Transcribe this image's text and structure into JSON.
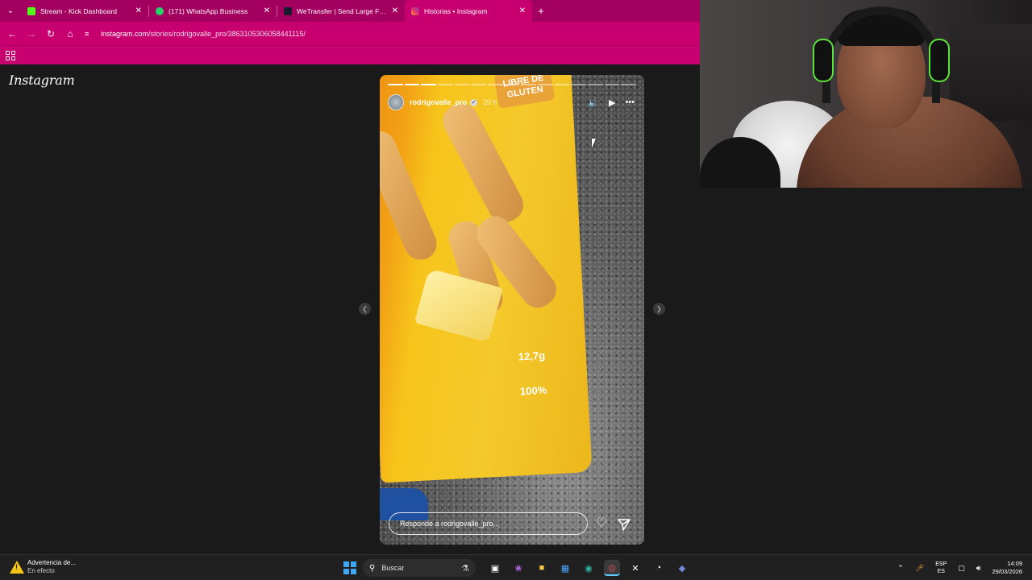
{
  "browser": {
    "tabs": [
      {
        "label": "Stream - Kick Dashboard",
        "favicon_color": "#53fc18",
        "active": false
      },
      {
        "label": "(171) WhatsApp Business",
        "favicon_color": "#25d366",
        "active": false
      },
      {
        "label": "WeTransfer | Send Large Files Fa",
        "favicon_color": "#1a1a2e",
        "active": false
      },
      {
        "label": "Historias • Instagram",
        "favicon_color": "#e1306c",
        "active": true
      }
    ],
    "url_host": "instagram.com",
    "url_path": "/stories/rodrigovalle_pro/3863105306058441115/",
    "theme_color": "#c8006f"
  },
  "page": {
    "logo": "Instagram"
  },
  "story": {
    "username": "rodrigovalle_pro",
    "time_ago": "20 h",
    "reply_placeholder": "Responde a rodrigovalle_pro...",
    "segments_total": 15,
    "segments_done": 3,
    "bag_text_1": "LIBRE DE GLUTEN",
    "bag_text_2": "12,7g",
    "bag_text_3": "100%"
  },
  "taskbar": {
    "weather_title": "Advertencia de...",
    "weather_sub": "En efecto",
    "search_label": "Buscar",
    "lang_top": "ESP",
    "lang_bottom": "ES",
    "time": "14:09",
    "date": "29/03/2026"
  }
}
